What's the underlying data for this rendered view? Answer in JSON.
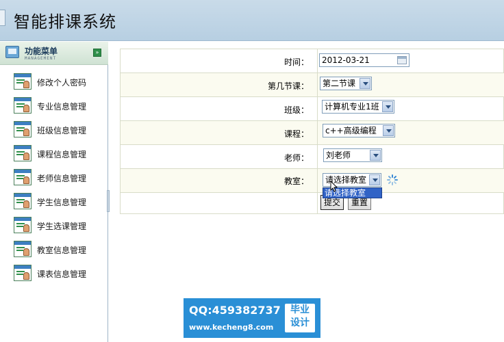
{
  "header": {
    "title": "智能排课系统"
  },
  "sidebar": {
    "menu_title": "功能菜单",
    "menu_subtitle": "MANAGEMENT",
    "items": [
      {
        "label": "修改个人密码"
      },
      {
        "label": "专业信息管理"
      },
      {
        "label": "班级信息管理"
      },
      {
        "label": "课程信息管理"
      },
      {
        "label": "老师信息管理"
      },
      {
        "label": "学生信息管理"
      },
      {
        "label": "学生选课管理"
      },
      {
        "label": "教室信息管理"
      },
      {
        "label": "课表信息管理"
      }
    ]
  },
  "form": {
    "time": {
      "label": "时间：",
      "value": "2012-03-21"
    },
    "period": {
      "label": "第几节课：",
      "value": "第二节课"
    },
    "class": {
      "label": "班级：",
      "value": "计算机专业1班"
    },
    "course": {
      "label": "课程：",
      "value": "c++高级编程"
    },
    "teacher": {
      "label": "老师：",
      "value": "刘老师"
    },
    "room": {
      "label": "教室：",
      "value": "请选择教室",
      "options": [
        "请选择教室"
      ]
    },
    "submit_label": "提交",
    "reset_label": "重置"
  },
  "watermark": {
    "qq": "QQ:459382737",
    "url": "www.kecheng8.com",
    "badge_line1": "毕业",
    "badge_line2": "设计",
    "color": "#2a8fd6"
  }
}
